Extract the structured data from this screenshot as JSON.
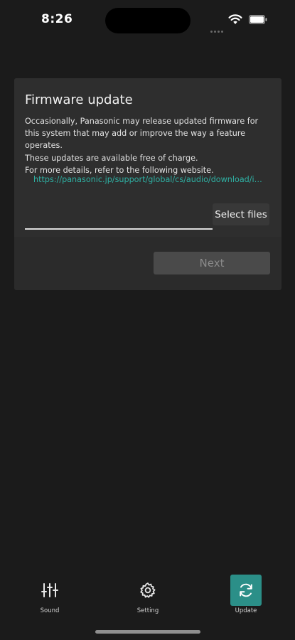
{
  "status_bar": {
    "time": "8:26"
  },
  "firmware": {
    "title": "Firmware update",
    "description": "Occasionally, Panasonic may release updated firmware for this system that may add or improve the way a feature operates.\nThese updates are available free of charge.\nFor more details, refer to the following website.",
    "link": "https://panasonic.jp/support/global/cs/audio/download/index.html",
    "select_files_label": "Select files",
    "next_label": "Next"
  },
  "tabs": [
    {
      "label": "Sound",
      "icon": "sliders-icon",
      "active": false
    },
    {
      "label": "Setting",
      "icon": "gear-icon",
      "active": false
    },
    {
      "label": "Update",
      "icon": "refresh-icon",
      "active": true
    }
  ],
  "colors": {
    "background": "#1b1b1b",
    "card": "#2e2e2e",
    "link": "#2fb1a4",
    "accent": "#2b8f88"
  }
}
